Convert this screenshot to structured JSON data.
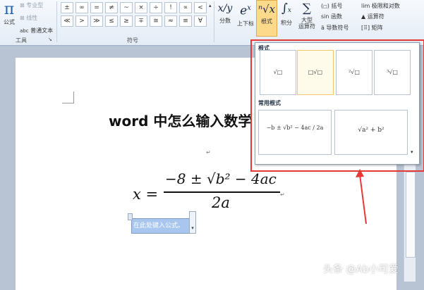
{
  "ribbon": {
    "equation_label": "公式",
    "pro_label": "专业型",
    "linear_label": "线性",
    "normal_text_label": "普通文本",
    "abc_prefix": "abc",
    "tools_group": "工具",
    "symbols_group": "符号",
    "symbols_row1": [
      "±",
      "∞",
      "=",
      "≠",
      "~",
      "×",
      "÷",
      "!",
      "∝",
      "<"
    ],
    "symbols_row2": [
      "≪",
      ">",
      "≫",
      "≤",
      "≥",
      "∓",
      "≅",
      "≈",
      "≡",
      "∀"
    ],
    "fraction_label": "分数",
    "script_label": "上下标",
    "radical_label": "根式",
    "integral_label": "积分",
    "large_operator_label": "大型\n运算符",
    "bracket_label": "括号",
    "function_label": "函数",
    "accent_label": "导数符号",
    "limit_label": "极限和对数",
    "operator_label": "运算符",
    "matrix_label": "矩阵"
  },
  "document": {
    "title": "word 中怎么输入数学",
    "equation_lhs": "x =",
    "equation_numerator": "−8 ± √b² − 4ac",
    "equation_denominator": "2a",
    "formula_placeholder": "在此处键入公式。",
    "para_mark": "↵"
  },
  "dropdown": {
    "section_radicals": "根式",
    "section_common": "常用根式",
    "radical_items": [
      "√□",
      "□√□",
      "²√□",
      "³√□"
    ],
    "common_items": [
      "−b ± √b² − 4ac / 2a",
      "√a² + b²"
    ]
  },
  "watermark": "头条 @Ab小可爱",
  "colors": {
    "highlight_red": "#e53935",
    "ribbon_bg": "#e4ecf6",
    "selection_blue": "#a8c6ee"
  }
}
